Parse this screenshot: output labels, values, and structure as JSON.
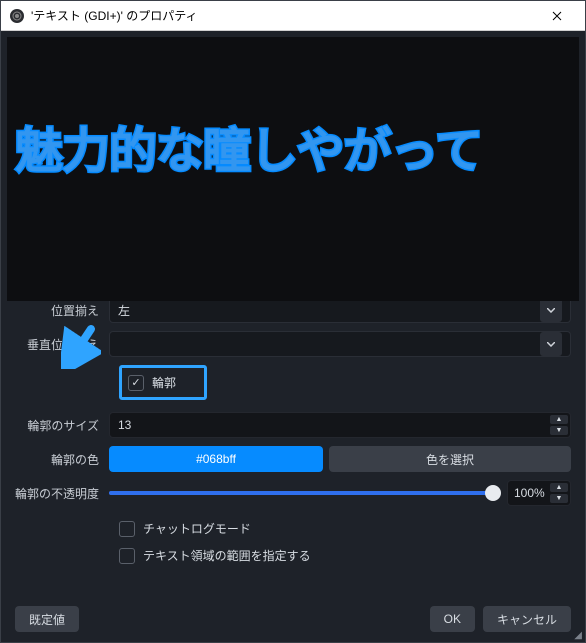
{
  "window": {
    "title": "'テキスト (GDI+)' のプロパティ"
  },
  "preview": {
    "text": "魅力的な瞳しやがって"
  },
  "rows": {
    "row_top": {
      "label": "位置揃え",
      "value": "左"
    },
    "valign": {
      "label": "垂直位置揃え",
      "value": ""
    },
    "outline_check": {
      "label": "輪郭"
    },
    "outline_size": {
      "label": "輪郭のサイズ",
      "value": "13"
    },
    "outline_color": {
      "label": "輪郭の色",
      "value": "#068bff",
      "pick": "色を選択"
    },
    "outline_opacity": {
      "label": "輪郭の不透明度",
      "value": "100%"
    },
    "chatlog": {
      "label": "チャットログモード"
    },
    "bounds": {
      "label": "テキスト領域の範囲を指定する"
    }
  },
  "footer": {
    "defaults": "既定値",
    "ok": "OK",
    "cancel": "キャンセル"
  }
}
